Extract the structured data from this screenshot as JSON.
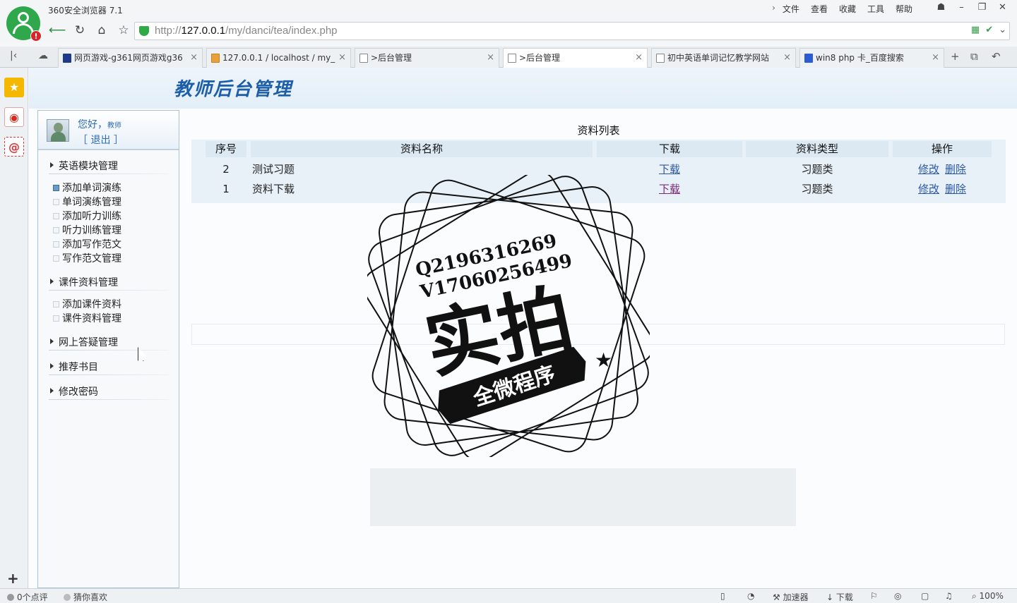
{
  "browser": {
    "title": "360安全浏览器 7.1",
    "menu": [
      "文件",
      "查看",
      "收藏",
      "工具",
      "帮助"
    ],
    "url_prefix": "http://",
    "url_host": "127.0.0.1",
    "url_path": "/my/danci/tea/index.php",
    "tabs": [
      {
        "label": "网页游戏-g361网页游戏g36"
      },
      {
        "label": "127.0.0.1 / localhost / my_"
      },
      {
        "label": ">后台管理"
      },
      {
        "label": ">后台管理"
      },
      {
        "label": "初中英语单词记忆教学网站"
      },
      {
        "label": "win8 php 卡_百度搜索"
      }
    ]
  },
  "page": {
    "banner_title": "教师后台管理",
    "user": {
      "greeting": "您好，",
      "role": "教师",
      "logout": "［ 退出 ］"
    },
    "sections": [
      {
        "label": "英语模块管理",
        "items": [
          "添加单词演练",
          "单词演练管理",
          "添加听力训练",
          "听力训练管理",
          "添加写作范文",
          "写作范文管理"
        ]
      },
      {
        "label": "课件资料管理",
        "items": [
          "添加课件资料",
          "课件资料管理"
        ]
      },
      {
        "label": "网上答疑管理"
      },
      {
        "label": "推荐书目"
      },
      {
        "label": "修改密码"
      }
    ],
    "table": {
      "caption": "资料列表",
      "headers": [
        "序号",
        "资料名称",
        "下载",
        "资料类型",
        "操作"
      ],
      "rows": [
        {
          "id": "2",
          "name": "测试习题",
          "download": "下载",
          "type": "习题类",
          "edit": "修改",
          "delete": "删除"
        },
        {
          "id": "1",
          "name": "资料下载",
          "download": "下载",
          "type": "习题类",
          "edit": "修改",
          "delete": "删除"
        }
      ]
    }
  },
  "watermark": {
    "line1": "Q2196316269",
    "line2": "V17060256499",
    "big": "实拍",
    "ribbon": "全微程序"
  },
  "statusbar": {
    "comments": "0个点评",
    "guess": "猜你喜欢",
    "accelerator": "加速器",
    "download": "下载",
    "zoom": "100%"
  }
}
